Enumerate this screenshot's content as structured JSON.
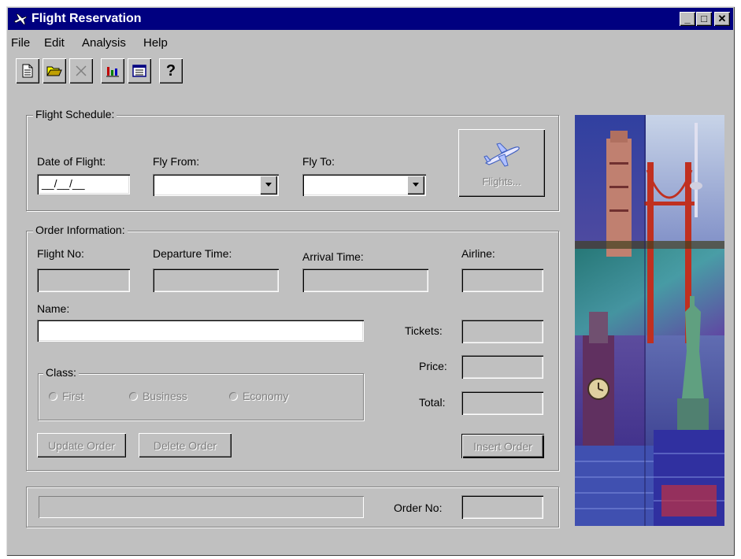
{
  "window": {
    "title": "Flight Reservation"
  },
  "title_buttons": {
    "minimize": "_",
    "maximize": "□",
    "close": "✕"
  },
  "menu": [
    "File",
    "Edit",
    "Analysis",
    "Help"
  ],
  "toolbar": {
    "buttons": [
      {
        "name": "new-order",
        "icon": "document-icon"
      },
      {
        "name": "open-order",
        "icon": "folder-open-icon"
      },
      {
        "name": "delete",
        "icon": "close-x-icon"
      },
      {
        "name": "graphs",
        "icon": "bar-chart-icon"
      },
      {
        "name": "reports",
        "icon": "report-icon"
      },
      {
        "name": "help",
        "icon": "question-icon",
        "label": "?"
      }
    ]
  },
  "flight_schedule": {
    "title": "Flight Schedule:",
    "date_label": "Date of Flight:",
    "date_value": "__/__/__",
    "from_label": "Fly From:",
    "from_value": "",
    "to_label": "Fly To:",
    "to_value": "",
    "flights_button": "Flights..."
  },
  "order_info": {
    "title": "Order Information:",
    "flight_no_label": "Flight No:",
    "flight_no_value": "",
    "departure_label": "Departure Time:",
    "departure_value": "",
    "arrival_label": "Arrival Time:",
    "arrival_value": "",
    "airline_label": "Airline:",
    "airline_value": "",
    "name_label": "Name:",
    "name_value": "",
    "tickets_label": "Tickets:",
    "tickets_value": "",
    "price_label": "Price:",
    "price_value": "",
    "total_label": "Total:",
    "total_value": "",
    "class": {
      "title": "Class:",
      "options": [
        "First",
        "Business",
        "Economy"
      ],
      "selected": null
    },
    "update_button": "Update Order",
    "delete_button": "Delete Order",
    "insert_button": "Insert Order"
  },
  "status": {
    "order_no_label": "Order No:",
    "order_no_value": ""
  },
  "colors": {
    "titlebar": "#000080",
    "face": "#c0c0c0",
    "disabled_text": "#808080"
  }
}
